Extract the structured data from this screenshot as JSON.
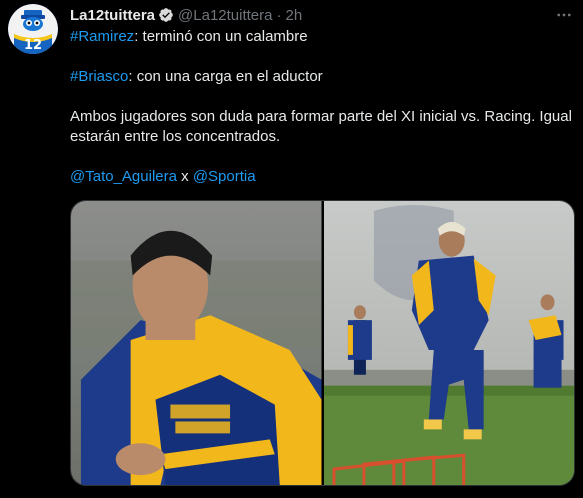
{
  "tweet": {
    "author_name": "La12tuittera",
    "author_handle": "@La12tuittera",
    "separator": "·",
    "time": "2h",
    "more_label": "···",
    "lines": [
      {
        "mention": "#Ramirez",
        "rest": ": terminó con un calambre"
      },
      {
        "mention": "#Briasco",
        "rest": ": con una carga en el aductor"
      }
    ],
    "paragraph": "Ambos jugadores son duda para formar parte del XI inicial vs. Racing. Igual estarán entre los concentrados.",
    "credits": {
      "first": "@Tato_Aguilera",
      "joiner": " x ",
      "second": "@Sportia"
    },
    "avatar_badge": "12"
  },
  "colors": {
    "link": "#1d9bf0",
    "bg": "#000000",
    "muted": "#71767b",
    "text": "#e7e9ea"
  },
  "icons": {
    "verified": "verified-badge-icon",
    "more": "more-options-icon"
  }
}
